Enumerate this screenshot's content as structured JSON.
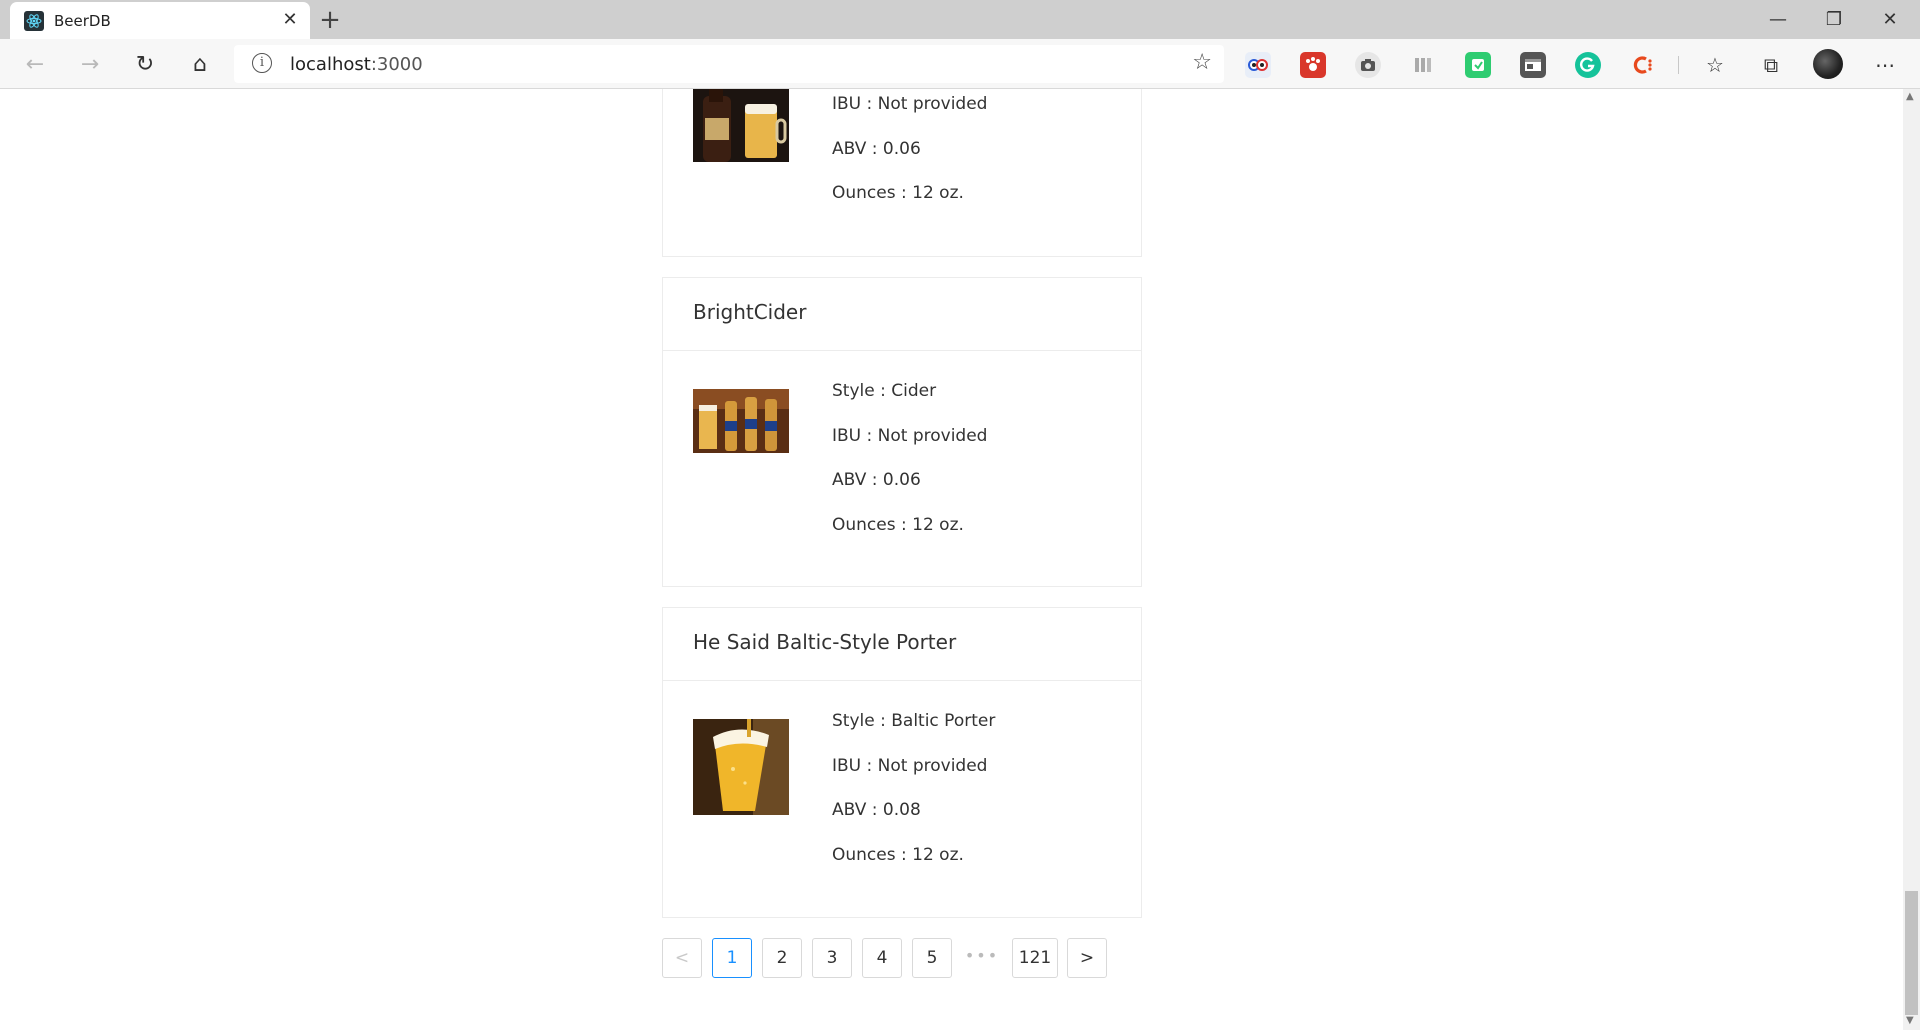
{
  "browser": {
    "tab_title": "BeerDB",
    "url_host": "localhost",
    "url_port": ":3000",
    "window_controls": [
      "minimize",
      "restore",
      "close"
    ]
  },
  "beers": [
    {
      "name": "",
      "style_label": "",
      "ibu": "IBU : Not provided",
      "abv": "ABV : 0.06",
      "ounces": "Ounces : 12 oz.",
      "image": "beer-bottle-and-glass"
    },
    {
      "name": "BrightCider",
      "style_label": "Style : Cider",
      "ibu": "IBU : Not provided",
      "abv": "ABV : 0.06",
      "ounces": "Ounces : 12 oz.",
      "image": "beer-bottles-row"
    },
    {
      "name": "He Said Baltic-Style Porter",
      "style_label": "Style : Baltic Porter",
      "ibu": "IBU : Not provided",
      "abv": "ABV : 0.08",
      "ounces": "Ounces : 12 oz.",
      "image": "beer-glass-pour"
    }
  ],
  "pagination": {
    "prev": "<",
    "pages": [
      "1",
      "2",
      "3",
      "4",
      "5"
    ],
    "ellipsis": "•••",
    "last": "121",
    "next": ">",
    "current": "1",
    "accent": "#1890ff"
  }
}
